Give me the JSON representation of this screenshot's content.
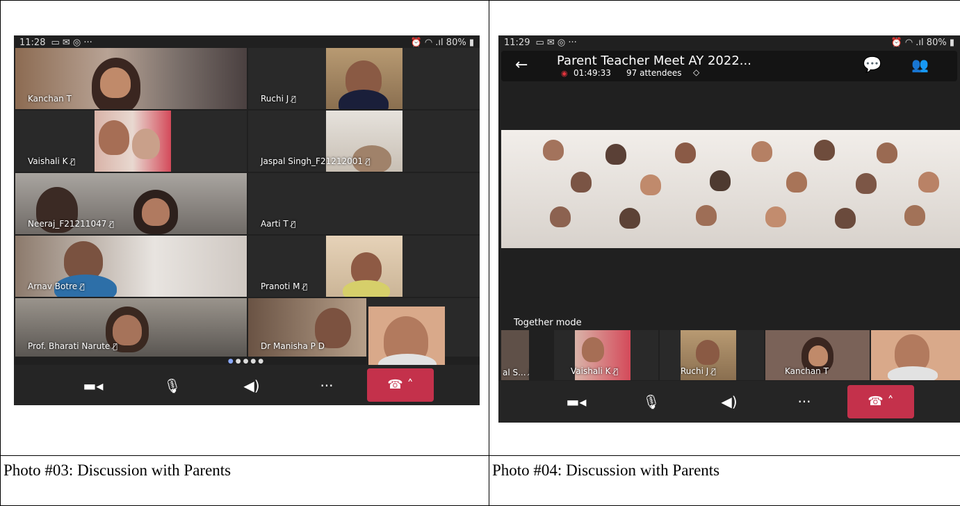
{
  "captions": {
    "left": "Photo #03: Discussion with Parents",
    "right": "Photo #04:  Discussion with Parents"
  },
  "left_screenshot": {
    "status": {
      "time": "11:28",
      "battery": "80%"
    },
    "tiles": [
      {
        "name": "Kanchan T",
        "muted": false
      },
      {
        "name": "Ruchi J",
        "muted": true
      },
      {
        "name": "Vaishali K",
        "muted": true
      },
      {
        "name": "Jaspal Singh_F21212001",
        "muted": true
      },
      {
        "name": "Neeraj_F21211047",
        "muted": true
      },
      {
        "name": "Aarti T",
        "muted": true
      },
      {
        "name": "Arnav Botre",
        "muted": true
      },
      {
        "name": "Pranoti M",
        "muted": true
      },
      {
        "name": "Prof. Bharati Narute",
        "muted": true
      },
      {
        "name": "Dr Manisha P D",
        "muted": false
      }
    ],
    "page_dots": {
      "total": 5,
      "active": 1
    }
  },
  "right_screenshot": {
    "status": {
      "time": "11:29",
      "battery": "80%"
    },
    "meeting": {
      "title": "Parent Teacher Meet AY 2022...",
      "duration": "01:49:33",
      "attendees": "97 attendees"
    },
    "mode_label": "Together mode",
    "strip": [
      {
        "name": "al S...",
        "muted": true
      },
      {
        "name": "Vaishali K",
        "muted": true
      },
      {
        "name": "Ruchi J",
        "muted": true
      },
      {
        "name": "Kanchan T",
        "muted": false
      }
    ]
  },
  "icons": {
    "camera": "camera-icon",
    "mic": "mic-icon",
    "speaker": "speaker-icon",
    "more": "more-icon",
    "end_call": "end-call-icon",
    "mute": "mic-off-icon"
  },
  "colors": {
    "end_call": "#c4314b",
    "app_bg": "#202020",
    "tile_bg": "#292929",
    "active_dot": "#8aa9ff"
  }
}
